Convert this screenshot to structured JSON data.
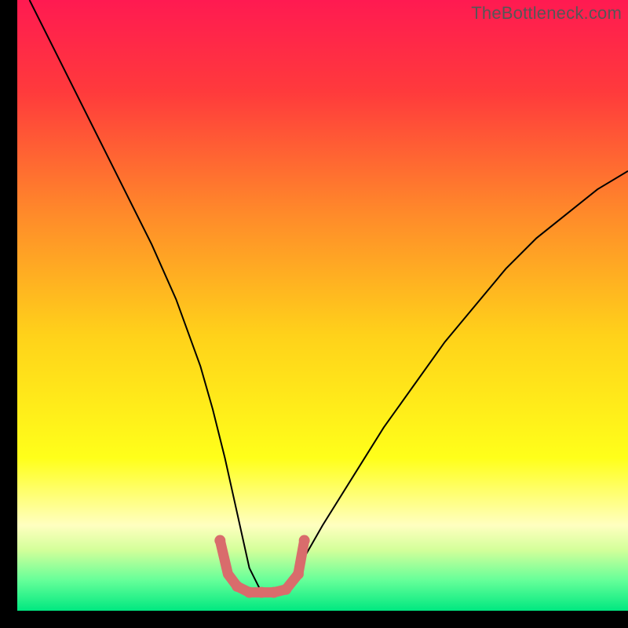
{
  "watermark": "TheBottleneck.com",
  "chart_data": {
    "type": "line",
    "title": "",
    "xlabel": "",
    "ylabel": "",
    "xlim": [
      0,
      100
    ],
    "ylim": [
      0,
      100
    ],
    "grid": false,
    "legend": false,
    "gradient_stops": [
      {
        "offset": 0,
        "color": "#ff1a51"
      },
      {
        "offset": 0.15,
        "color": "#ff3a3c"
      },
      {
        "offset": 0.35,
        "color": "#ff8a2a"
      },
      {
        "offset": 0.55,
        "color": "#ffd21a"
      },
      {
        "offset": 0.75,
        "color": "#ffff1a"
      },
      {
        "offset": 0.86,
        "color": "#ffffc0"
      },
      {
        "offset": 0.9,
        "color": "#d4ff9a"
      },
      {
        "offset": 0.95,
        "color": "#66ff99"
      },
      {
        "offset": 1.0,
        "color": "#00e880"
      }
    ],
    "series": [
      {
        "name": "bottleneck-curve",
        "stroke": "#000000",
        "stroke_width": 2,
        "x": [
          2,
          6,
          10,
          14,
          18,
          22,
          26,
          30,
          32,
          34,
          36,
          38,
          40,
          42,
          44,
          46,
          50,
          55,
          60,
          65,
          70,
          75,
          80,
          85,
          90,
          95,
          100
        ],
        "y": [
          100,
          92,
          84,
          76,
          68,
          60,
          51,
          40,
          33,
          25,
          16,
          7,
          3,
          3,
          3,
          7,
          14,
          22,
          30,
          37,
          44,
          50,
          56,
          61,
          65,
          69,
          72
        ]
      },
      {
        "name": "flat-bottom-highlight",
        "stroke": "#d96c6c",
        "stroke_width": 13,
        "linecap": "round",
        "x": [
          33.2,
          34.5,
          36,
          38,
          40,
          42,
          44,
          46,
          47.0
        ],
        "y": [
          11.5,
          6,
          4,
          3,
          3,
          3,
          3.5,
          6,
          11.5
        ]
      }
    ],
    "highlight_dots": {
      "color": "#d96c6c",
      "radius": 7,
      "points": [
        {
          "x": 33.2,
          "y": 11.5
        },
        {
          "x": 36,
          "y": 4
        },
        {
          "x": 38,
          "y": 3
        },
        {
          "x": 40,
          "y": 3
        },
        {
          "x": 42,
          "y": 3
        },
        {
          "x": 44,
          "y": 3.5
        },
        {
          "x": 46,
          "y": 6
        },
        {
          "x": 47.0,
          "y": 11.5
        }
      ]
    }
  }
}
